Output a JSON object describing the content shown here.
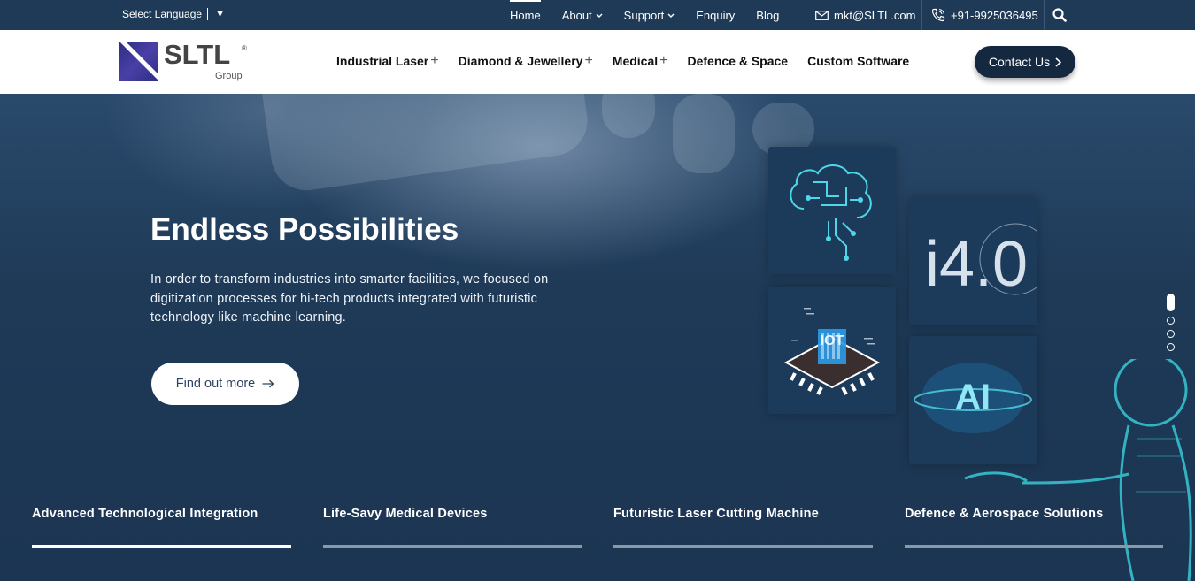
{
  "topbar": {
    "language": "Select Language",
    "language_caret": "▼",
    "nav": [
      {
        "label": "Home",
        "active": true
      },
      {
        "label": "About",
        "dropdown": true
      },
      {
        "label": "Support",
        "dropdown": true
      },
      {
        "label": "Enquiry"
      },
      {
        "label": "Blog"
      }
    ],
    "email": "mkt@SLTL.com",
    "phone": "+91-9925036495",
    "icons": {
      "email": "mail-icon",
      "phone": "phone-icon",
      "search": "search-icon"
    }
  },
  "header": {
    "logo_word": "SLTL",
    "logo_reg": "®",
    "logo_sub": "Group",
    "nav": [
      {
        "label": "Industrial Laser",
        "plus": "+"
      },
      {
        "label": "Diamond & Jewellery",
        "plus": "+"
      },
      {
        "label": "Medical",
        "plus": "+"
      },
      {
        "label": "Defence & Space",
        "plus": ""
      },
      {
        "label": "Custom Software",
        "plus": ""
      }
    ],
    "contact_label": "Contact Us"
  },
  "hero": {
    "title": "Endless Possibilities",
    "text": "In order to transform industries into smarter facilities, we focused on digitization processes for hi-tech products integrated with futuristic technology like machine learning.",
    "cta_label": "Find out more",
    "tiles": {
      "iot_label": "IOT",
      "i40_label": "i4.0",
      "ai_label": "AI"
    }
  },
  "carousel": {
    "slide_count": 4,
    "active_index": 0
  },
  "tabs": [
    {
      "label": "Advanced Technological Integration",
      "active": true
    },
    {
      "label": "Life-Savy Medical Devices",
      "active": false
    },
    {
      "label": "Futuristic Laser Cutting Machine",
      "active": false
    },
    {
      "label": "Defence & Aerospace Solutions",
      "active": false
    }
  ],
  "colors": {
    "topbar_bg": "#1f3a56",
    "hero_bg": "#1e3a57",
    "contact_btn": "#14293f",
    "accent_cyan": "#4fd6e8"
  }
}
